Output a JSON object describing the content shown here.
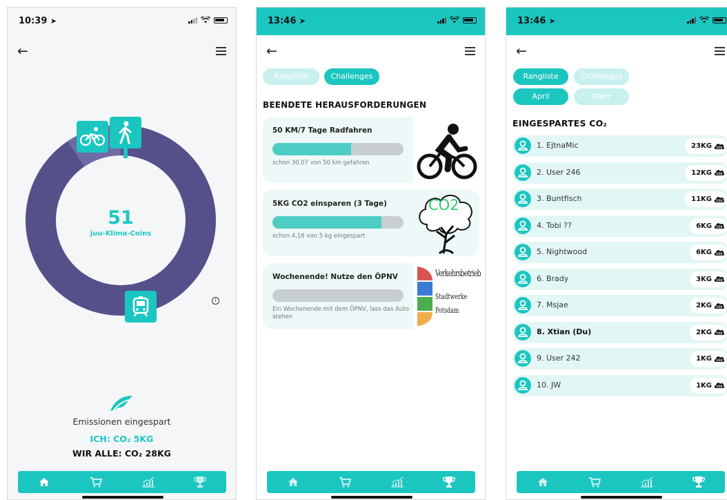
{
  "screen1": {
    "time": "10:39",
    "coins_value": "51",
    "coins_label": "juu-Klima-Coins",
    "emissions_label": "Emissionen eingespart",
    "ich": "ICH: CO₂ 5KG",
    "wir_alle": "WIR ALLE: CO₂ 28KG"
  },
  "screen2": {
    "time": "13:46",
    "tab_rangliste": "Rangliste",
    "tab_challenges": "Challenges",
    "section_title": "BEENDETE HERAUSFORDERUNGEN",
    "challenges": [
      {
        "title": "50 KM/7 Tage Radfahren",
        "sub": "schon 30,07 von 50 km gefahren",
        "progress": 0.6
      },
      {
        "title": "5KG CO2 einsparen (3 Tage)",
        "sub": "schon 4,16 von 5 kg eingespart",
        "progress": 0.83
      },
      {
        "title": "Wochenende! Nutze den ÖPNV",
        "sub": "Ein Wochenende mit dem ÖPNV, lass das Auto stehen",
        "progress": 0
      }
    ],
    "co2_tree_text": "CO2",
    "vbp_title": "Verkehrsbetrieb",
    "vbp_line1": "Stadtwerke",
    "vbp_line2": "Potsdam"
  },
  "screen3": {
    "time": "13:46",
    "tab_rangliste": "Rangliste",
    "tab_challenges": "Challenges",
    "tab_april": "April",
    "tab_maerz": "März",
    "section_title": "EINGESPARTES CO₂",
    "ranking": [
      {
        "name": "1. EjtnaMic",
        "kg": "23KG",
        "me": false
      },
      {
        "name": "2. User 246",
        "kg": "12KG",
        "me": false
      },
      {
        "name": "3. Buntfisch",
        "kg": "11KG",
        "me": false
      },
      {
        "name": "4. Tobi ??",
        "kg": "6KG",
        "me": false
      },
      {
        "name": "5. Nightwood",
        "kg": "6KG",
        "me": false
      },
      {
        "name": "6. Brady",
        "kg": "3KG",
        "me": false
      },
      {
        "name": "7. Msjae",
        "kg": "2KG",
        "me": false
      },
      {
        "name": "8. Xtian (Du)",
        "kg": "2KG",
        "me": true
      },
      {
        "name": "9. User 242",
        "kg": "1KG",
        "me": false
      },
      {
        "name": "10. JW",
        "kg": "1KG",
        "me": false
      }
    ]
  },
  "colors": {
    "teal": "#1cc6c0",
    "donut": "#55508a"
  },
  "icons": {
    "nav": [
      "home-icon",
      "cart-icon",
      "chart-icon",
      "trophy-icon"
    ],
    "modes": [
      "bicycle-icon",
      "walking-icon",
      "tram-icon"
    ]
  }
}
